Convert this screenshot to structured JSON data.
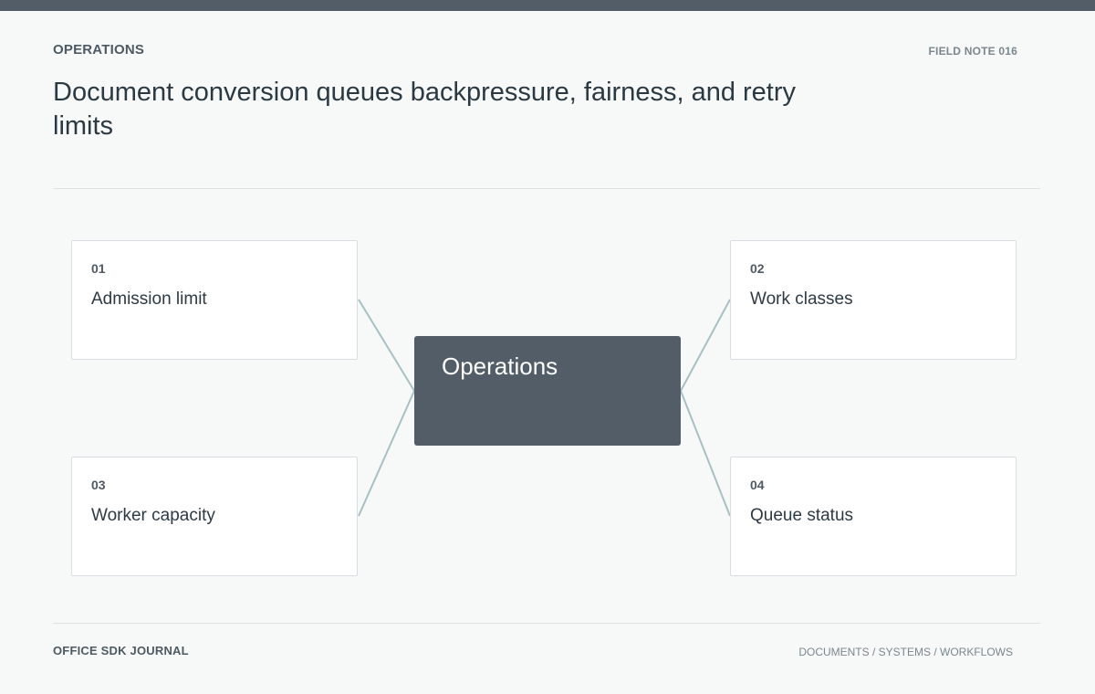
{
  "header": {
    "section": "OPERATIONS",
    "note": "FIELD NOTE 016",
    "title": "Document conversion queues backpressure, fairness, and retry limits"
  },
  "diagram": {
    "hub": "Operations",
    "nodes": [
      {
        "number": "01",
        "label": "Admission limit"
      },
      {
        "number": "02",
        "label": "Work classes"
      },
      {
        "number": "03",
        "label": "Worker capacity"
      },
      {
        "number": "04",
        "label": "Queue status"
      }
    ],
    "colors": {
      "hub": "#525d67",
      "connector": "#a8bfc3",
      "card_border": "#d8dee1"
    }
  },
  "footer": {
    "publication": "OFFICE SDK JOURNAL",
    "categories": "DOCUMENTS / SYSTEMS / WORKFLOWS"
  }
}
